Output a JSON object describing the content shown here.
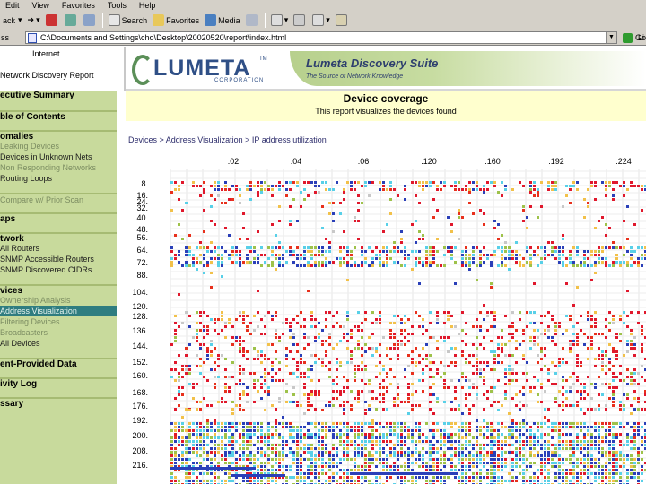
{
  "browser": {
    "menu": [
      "Edit",
      "View",
      "Favorites",
      "Tools",
      "Help"
    ],
    "toolbar": {
      "back": "ack",
      "search": "Search",
      "favorites": "Favorites",
      "media": "Media"
    },
    "address_label": "ss",
    "address_value": "C:\\Documents and Settings\\cho\\Desktop\\20020520\\report\\index.html",
    "go_label": "Go",
    "links_label": "Li"
  },
  "left_frame": {
    "internet_label": "Internet",
    "report_title": "Network Discovery Report",
    "nav": [
      {
        "type": "head",
        "label": "ecutive Summary"
      },
      {
        "type": "head",
        "label": "ble of Contents",
        "gap": true
      },
      {
        "type": "head",
        "label": "omalies",
        "gap": true
      },
      {
        "type": "sub",
        "label": "Leaking Devices"
      },
      {
        "type": "sub",
        "label": "Devices in Unknown Nets",
        "dark": true
      },
      {
        "type": "sub",
        "label": "Non Responding Networks"
      },
      {
        "type": "sub",
        "label": "Routing Loops",
        "dark": true
      },
      {
        "type": "sub",
        "label": "Compare w/ Prior Scan",
        "gap": true
      },
      {
        "type": "head",
        "label": "aps",
        "gap": true
      },
      {
        "type": "head",
        "label": "twork",
        "gap": true
      },
      {
        "type": "sub",
        "label": "All Routers",
        "dark": true
      },
      {
        "type": "sub",
        "label": "SNMP Accessible Routers",
        "dark": true
      },
      {
        "type": "sub",
        "label": "SNMP Discovered CIDRs",
        "dark": true
      },
      {
        "type": "head",
        "label": "vices",
        "gap": true
      },
      {
        "type": "sub",
        "label": "Ownership Analysis"
      },
      {
        "type": "sub",
        "label": "Address Visualization",
        "selected": true
      },
      {
        "type": "sub",
        "label": "Filtering Devices"
      },
      {
        "type": "sub",
        "label": "Broadcasters"
      },
      {
        "type": "sub",
        "label": "All Devices",
        "dark": true
      },
      {
        "type": "head",
        "label": "ent-Provided Data",
        "gap": true
      },
      {
        "type": "head",
        "label": "ivity Log",
        "gap": true
      },
      {
        "type": "head",
        "label": "ssary",
        "gap": true
      }
    ]
  },
  "banner": {
    "logo": "LUMETA",
    "logo_tm": "TM",
    "logo_sub": "CORPORATION",
    "suite_title": "Lumeta Discovery Suite",
    "suite_tagline": "The Source of Network Knowledge"
  },
  "content": {
    "title": "Device coverage",
    "subtitle": "This report visualizes the devices found",
    "breadcrumb": "Devices > Address Visualization > IP address utilization",
    "column_labels": [
      ".02",
      ".04",
      ".06",
      ".120",
      ".160",
      ".192",
      ".224"
    ],
    "row_labels": [
      "8.",
      "16.",
      "24.",
      "32.",
      "40.",
      "48.",
      "56.",
      "64.",
      "72.",
      "88.",
      "104.",
      "120.",
      "128.",
      "136.",
      "144.",
      "152.",
      "160.",
      "168.",
      "176.",
      "192.",
      "200.",
      "208.",
      "216."
    ],
    "dot_colors": [
      "#e0182c",
      "#e8301c",
      "#2a3fb8",
      "#f2c14a",
      "#58d0e8",
      "#9ec24a",
      "#c8c8c8"
    ]
  }
}
